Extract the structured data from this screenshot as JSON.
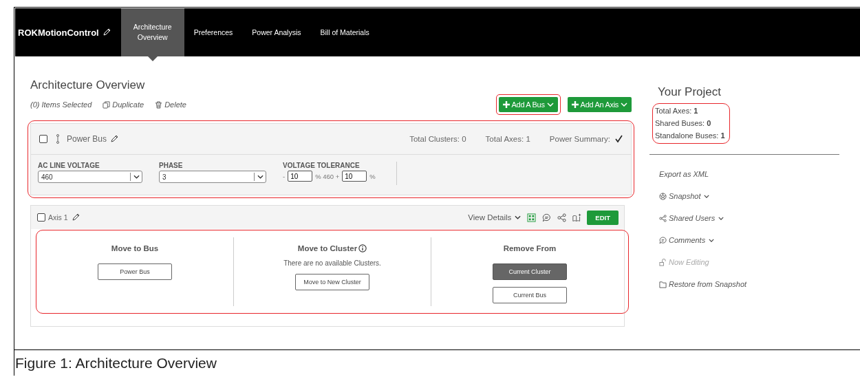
{
  "nav": {
    "brand": "ROKMotionControl",
    "tabs": [
      {
        "label": "Architecture Overview",
        "selected": true
      },
      {
        "label": "Preferences",
        "selected": false
      },
      {
        "label": "Power Analysis",
        "selected": false
      },
      {
        "label": "Bill of Materials",
        "selected": false
      }
    ]
  },
  "page_title": "Architecture Overview",
  "toolbar": {
    "selection": "(0) Items Selected",
    "actions": [
      {
        "label": "Duplicate",
        "kind": "duplicate"
      },
      {
        "label": "Delete",
        "kind": "delete"
      }
    ]
  },
  "add_buttons": [
    {
      "label": "Add A Bus",
      "highlighted": true
    },
    {
      "label": "Add An Axis",
      "highlighted": false
    }
  ],
  "bus": {
    "highlighted": true,
    "checked": false,
    "name": "Power Bus",
    "stats": [
      "Total Clusters: 0",
      "Total Axes: 1"
    ],
    "power_summary": "Power Summary:",
    "power_ok": true,
    "ac_line_voltage": {
      "label": "AC LINE VOLTAGE",
      "value": "460"
    },
    "phase": {
      "label": "PHASE",
      "value": "3"
    },
    "tolerance": {
      "label": "VOLTAGE TOLERANCE",
      "minus": "-",
      "low": "10",
      "mid": "% 460 +",
      "high": "10",
      "pct": "%"
    }
  },
  "axis": {
    "checked": false,
    "name": "Axis 1",
    "view_details": "View Details",
    "edit": "EDIT",
    "highlighted": true,
    "sections": [
      {
        "title": "Move to Bus",
        "info": false,
        "buttons": [
          {
            "label": "Power Bus",
            "selected": false
          }
        ]
      },
      {
        "title": "Move to Cluster",
        "info": true,
        "note": "There are no available Clusters.",
        "buttons": [
          {
            "label": "Move to New Cluster",
            "selected": false
          }
        ]
      },
      {
        "title": "Remove From",
        "info": false,
        "buttons": [
          {
            "label": "Current Cluster",
            "selected": true
          },
          {
            "label": "Current Bus",
            "selected": false
          }
        ]
      }
    ]
  },
  "project": {
    "title": "Your Project",
    "highlighted": true,
    "stats": [
      {
        "label": "Total Axes:",
        "value": "1"
      },
      {
        "label": "Shared Buses:",
        "value": "0"
      },
      {
        "label": "Standalone Buses:",
        "value": "1"
      }
    ],
    "menu": [
      {
        "label": "Export as XML",
        "kind": "none",
        "dropdown": false,
        "disabled": false
      },
      {
        "label": "Snapshot",
        "kind": "aperture",
        "dropdown": true,
        "disabled": false
      },
      {
        "label": "Shared Users",
        "kind": "share",
        "dropdown": true,
        "disabled": false
      },
      {
        "label": "Comments",
        "kind": "comment",
        "dropdown": true,
        "disabled": false
      },
      {
        "label": "Now Editing",
        "kind": "lock",
        "dropdown": false,
        "disabled": true
      },
      {
        "label": "Restore from Snapshot",
        "kind": "folder",
        "dropdown": false,
        "disabled": false
      }
    ]
  },
  "caption": "Figure 1: Architecture Overview"
}
